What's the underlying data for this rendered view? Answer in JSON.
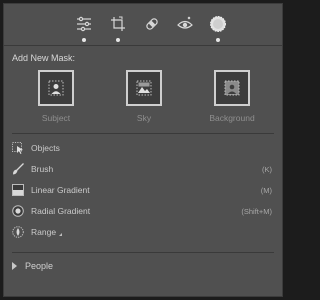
{
  "toolbar": {
    "tools": [
      {
        "name": "edit-sliders-icon"
      },
      {
        "name": "crop-icon"
      },
      {
        "name": "healing-icon"
      },
      {
        "name": "red-eye-icon"
      },
      {
        "name": "masking-icon",
        "active": true
      }
    ]
  },
  "add_mask": {
    "title": "Add New Mask:",
    "types": [
      {
        "label": "Subject",
        "icon": "subject-icon"
      },
      {
        "label": "Sky",
        "icon": "sky-icon"
      },
      {
        "label": "Background",
        "icon": "background-icon"
      }
    ]
  },
  "tools_list": [
    {
      "label": "Objects",
      "shortcut": "",
      "icon": "objects-icon"
    },
    {
      "label": "Brush",
      "shortcut": "(K)",
      "icon": "brush-icon"
    },
    {
      "label": "Linear Gradient",
      "shortcut": "(M)",
      "icon": "linear-gradient-icon"
    },
    {
      "label": "Radial Gradient",
      "shortcut": "(Shift+M)",
      "icon": "radial-gradient-icon"
    },
    {
      "label": "Range",
      "shortcut": "",
      "icon": "range-icon"
    }
  ],
  "people": {
    "label": "People"
  },
  "colors": {
    "panel": "#505050",
    "accent": "#e6e6e6"
  }
}
